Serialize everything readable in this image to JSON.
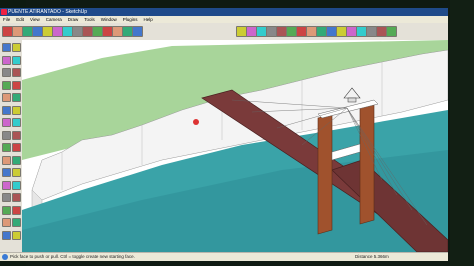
{
  "window": {
    "title": "PUENTE ATIRANTADO - SketchUp"
  },
  "menu": {
    "items": [
      "File",
      "Edit",
      "View",
      "Camera",
      "Draw",
      "Tools",
      "Window",
      "Plugins",
      "Help"
    ]
  },
  "status": {
    "message": "Pick face to push or pull.  Ctrl = toggle create new starting face.",
    "measurement": "Distance  5.366m"
  },
  "colors": {
    "title_bar": "#1f4a8a",
    "water": "#3aa3a8",
    "deck": "#7a3a3a",
    "tower": "#a0522d",
    "grass": "#9fcf8b",
    "sky": "#ffffff"
  },
  "toolbar": {
    "icons": [
      "select-icon",
      "eraser-icon",
      "paint-bucket-icon",
      "line-icon",
      "rectangle-icon",
      "circle-icon",
      "arc-icon",
      "push-pull-icon",
      "move-icon",
      "rotate-icon",
      "scale-icon",
      "offset-icon",
      "tape-measure-icon",
      "text-icon",
      "orbit-icon",
      "pan-icon",
      "zoom-icon",
      "zoom-extents-icon",
      "iso-view-icon",
      "top-view-icon",
      "front-view-icon",
      "right-view-icon",
      "back-view-icon",
      "left-view-icon",
      "xray-icon",
      "wireframe-icon",
      "hidden-line-icon",
      "shaded-icon",
      "shaded-texture-icon",
      "monochrome-icon"
    ]
  },
  "sidebar": {
    "icons": [
      "select-icon",
      "component-icon",
      "paint-bucket-icon",
      "eraser-icon",
      "rectangle-icon",
      "line-icon",
      "circle-icon",
      "arc-icon",
      "polygon-icon",
      "freehand-icon",
      "move-icon",
      "push-pull-icon",
      "rotate-icon",
      "follow-me-icon",
      "scale-icon",
      "offset-icon",
      "tape-measure-icon",
      "dimension-icon",
      "protractor-icon",
      "text-icon",
      "axes-icon",
      "3d-text-icon",
      "orbit-icon",
      "pan-icon",
      "zoom-icon",
      "zoom-window-icon",
      "zoom-extents-icon",
      "previous-view-icon",
      "position-camera-icon",
      "walk-icon",
      "look-around-icon",
      "section-plane-icon"
    ]
  }
}
